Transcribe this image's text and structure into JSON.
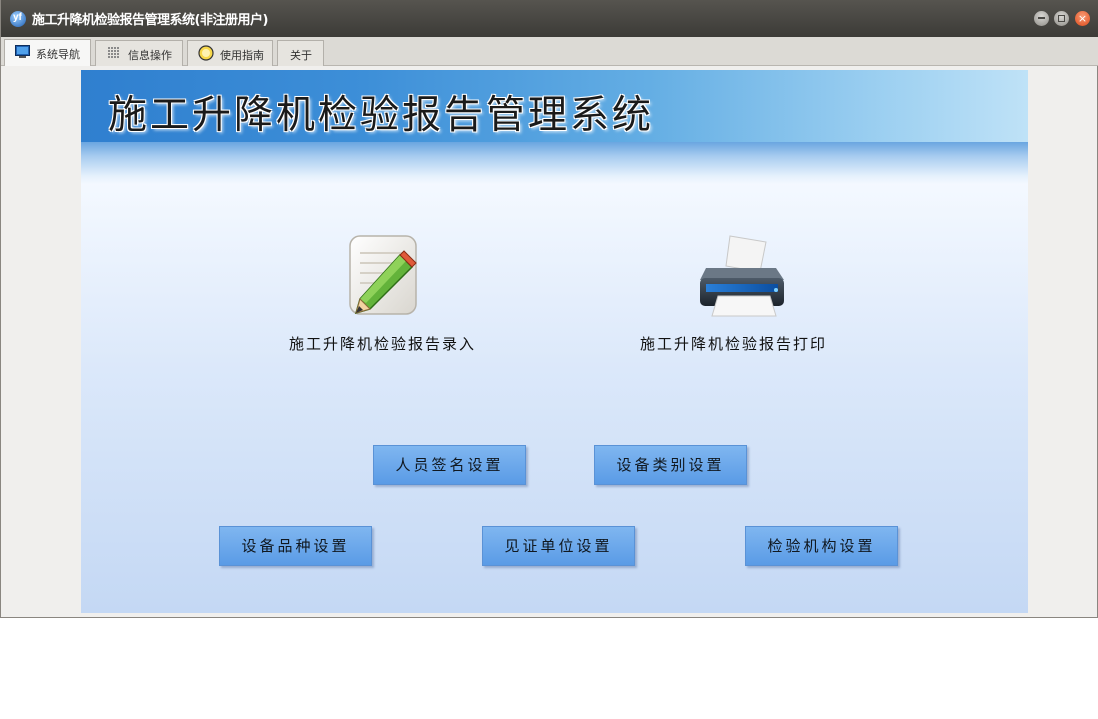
{
  "window": {
    "title": "施工升降机检验报告管理系统(非注册用户)",
    "app_icon": "yf",
    "controls": [
      "minimize-icon",
      "maximize-icon",
      "close-icon"
    ]
  },
  "tabs": [
    {
      "label": "系统导航",
      "icon": "monitor-icon",
      "active": true
    },
    {
      "label": "信息操作",
      "icon": "grid-icon",
      "active": false
    },
    {
      "label": "使用指南",
      "icon": "help-circle-icon",
      "active": false
    },
    {
      "label": "关于",
      "icon": "",
      "active": false
    }
  ],
  "main": {
    "banner_title": "施工升降机检验报告管理系统",
    "entry": {
      "label": "施工升降机检验报告录入",
      "icon": "notepad-pencil-icon"
    },
    "print": {
      "label": "施工升降机检验报告打印",
      "icon": "printer-icon"
    },
    "buttons": {
      "personnel_signature": "人员签名设置",
      "equipment_category": "设备类别设置",
      "equipment_variety": "设备品种设置",
      "witness_unit": "见证单位设置",
      "inspection_agency": "检验机构设置"
    }
  },
  "colors": {
    "titlebar": "#3c3b37",
    "button": "#6aa8ec",
    "banner": "#3d8fd8"
  }
}
